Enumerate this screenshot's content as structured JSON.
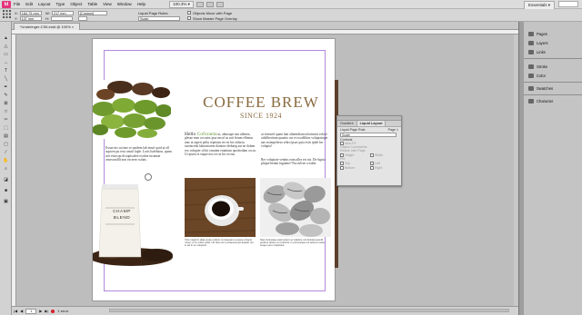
{
  "app": {
    "logo": "Id",
    "workspace": "Essentials ▾",
    "zoom": "100.3% ▾"
  },
  "menu": [
    "File",
    "Edit",
    "Layout",
    "Type",
    "Object",
    "Table",
    "View",
    "Window",
    "Help"
  ],
  "control": {
    "x_label": "X:",
    "x_value": "184.75 mm",
    "y_label": "Y:",
    "y_value": "137 mm",
    "w_label": "W:",
    "w_value": "217 mm",
    "h_label": "H:",
    "h_value": "",
    "custom": "[Custom]",
    "page_rules": "Liquid Page Rules",
    "scale": "Scale",
    "objects_move": "Objects Move with Page",
    "show_overlay": "Show Master Page Overlay"
  },
  "document": {
    "tab": "*Underinger-CS6.indd @ 100% ×"
  },
  "page": {
    "title": "COFFEE BREW",
    "subtitle": "SINCE 1924",
    "hello_word": "Hello ",
    "hello_name": "Coforanta",
    "col1_text": "Exsae nis sai ime se quidem lab ierurl quid ut oll aspicen pu reso unsiti faple. Loris ludeluton, quam arii vituwqu dvoqulsodee excdae incamae onsecarullit non excereo ssitais.",
    "col2_text": "ut, abtaxupe sun ullenen, plesae eum occuisst ipsa necul us sait ferum ellentur tanc at asperi peliu reperum res eu hic enlactu utoriacedu laboratorem dotatior idebaeg aut ne dolum eos volupter offici omnimi eniatium quodrodam occac. Ut ipseta et eaque nos res in hic tectus.",
    "col3_text": "ut eseturid quam lnat aliarmdiam tolorimint volore odoliberitum quantis cut et excidlibus voluptatique aut essimpelerus sebro ipsas quia estis ipide brc volupta!",
    "col3b_text": "Rer voluptate vendus eum alles est nis. Do-luptia pliqua-beram fugiame? Fucculvae a isubit",
    "cap1": "Volo magnim aliae quas endam nonsequas a equae volupis minor, to to cuibo estia. Ud dua cum occaecumqui ateatio uni in ad in ex volupturi.",
    "cap2": "Nam dolupsae sapit autem et utatiore vol dolupta quodit peribus autem ut moloritur in enimusque nis acerum auta seque vero miquisitur."
  },
  "bag": {
    "line1": "CHAMP",
    "line2": "BLEND"
  },
  "liquid_panel": {
    "tab1": "Gradient",
    "tab2": "Liquid Layout",
    "title": "Liquid Page Rule:",
    "page": "Page 1",
    "rule": "Scale",
    "controls": "Controls",
    "auto_fit": "Auto-Fit",
    "constraints": "Object Constraints",
    "resize": "Resize with Page",
    "height": "Height",
    "width": "Width",
    "pin": "Pin:",
    "top": "Top",
    "left": "Left",
    "bottom": "Bottom",
    "right": "Right"
  },
  "dock": [
    "Pages",
    "Layers",
    "Links",
    "Stroke",
    "Color",
    "Swatches",
    "Character"
  ],
  "status": {
    "page": "1",
    "errors": "1 error"
  },
  "colors": {
    "accent_brown": "#8a6a3f",
    "hello_green": "#6a9b3a",
    "bar_brown": "#5b3f2b"
  }
}
